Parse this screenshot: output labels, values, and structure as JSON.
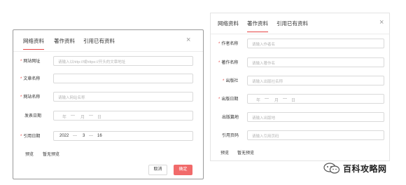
{
  "left": {
    "tabs": [
      "网络资料",
      "著作资料",
      "引用已有资料"
    ],
    "close": "×",
    "fields": [
      {
        "label": "网站网址",
        "required": true,
        "placeholder": "请输入以http://或https://开头的文章地址"
      },
      {
        "label": "文章名称",
        "required": true,
        "placeholder": ""
      },
      {
        "label": "网站名称",
        "required": true,
        "placeholder": "请输入网站名称"
      },
      {
        "label": "发表日期",
        "required": false,
        "date": [
          "年",
          "月",
          "日"
        ]
      },
      {
        "label": "引用日期",
        "required": true,
        "date": [
          "2022",
          "3",
          "16"
        ]
      }
    ],
    "preview_label": "预览",
    "preview_value": "暂无预览",
    "cancel": "取消",
    "ok": "确定",
    "date_sep": "—"
  },
  "right": {
    "tabs": [
      "网络资料",
      "著作资料",
      "引用已有资料"
    ],
    "close": "×",
    "fields": [
      {
        "label": "作者名称",
        "required": true,
        "placeholder": "请输入作者名"
      },
      {
        "label": "著作名称",
        "required": true,
        "placeholder": "请输入著作名"
      },
      {
        "label": "出版社",
        "required": true,
        "placeholder": "请输入出版社名称"
      },
      {
        "label": "出版日期",
        "required": true,
        "date": [
          "年",
          "月",
          "日"
        ]
      },
      {
        "label": "出版篇地",
        "required": false,
        "placeholder": "请输入出版地"
      },
      {
        "label": "引用页码",
        "required": false,
        "placeholder": "请输入引用页码"
      }
    ],
    "preview_label": "预览",
    "preview_value": "暂无预览",
    "date_sep": "—"
  },
  "watermark": {
    "text": "百科攻略网",
    "icon": "wechat-icon"
  },
  "colors": {
    "accent": "#e64545",
    "ok_button": "#f16a6a",
    "border": "#d9d9d9",
    "placeholder": "#b5b5b5"
  }
}
